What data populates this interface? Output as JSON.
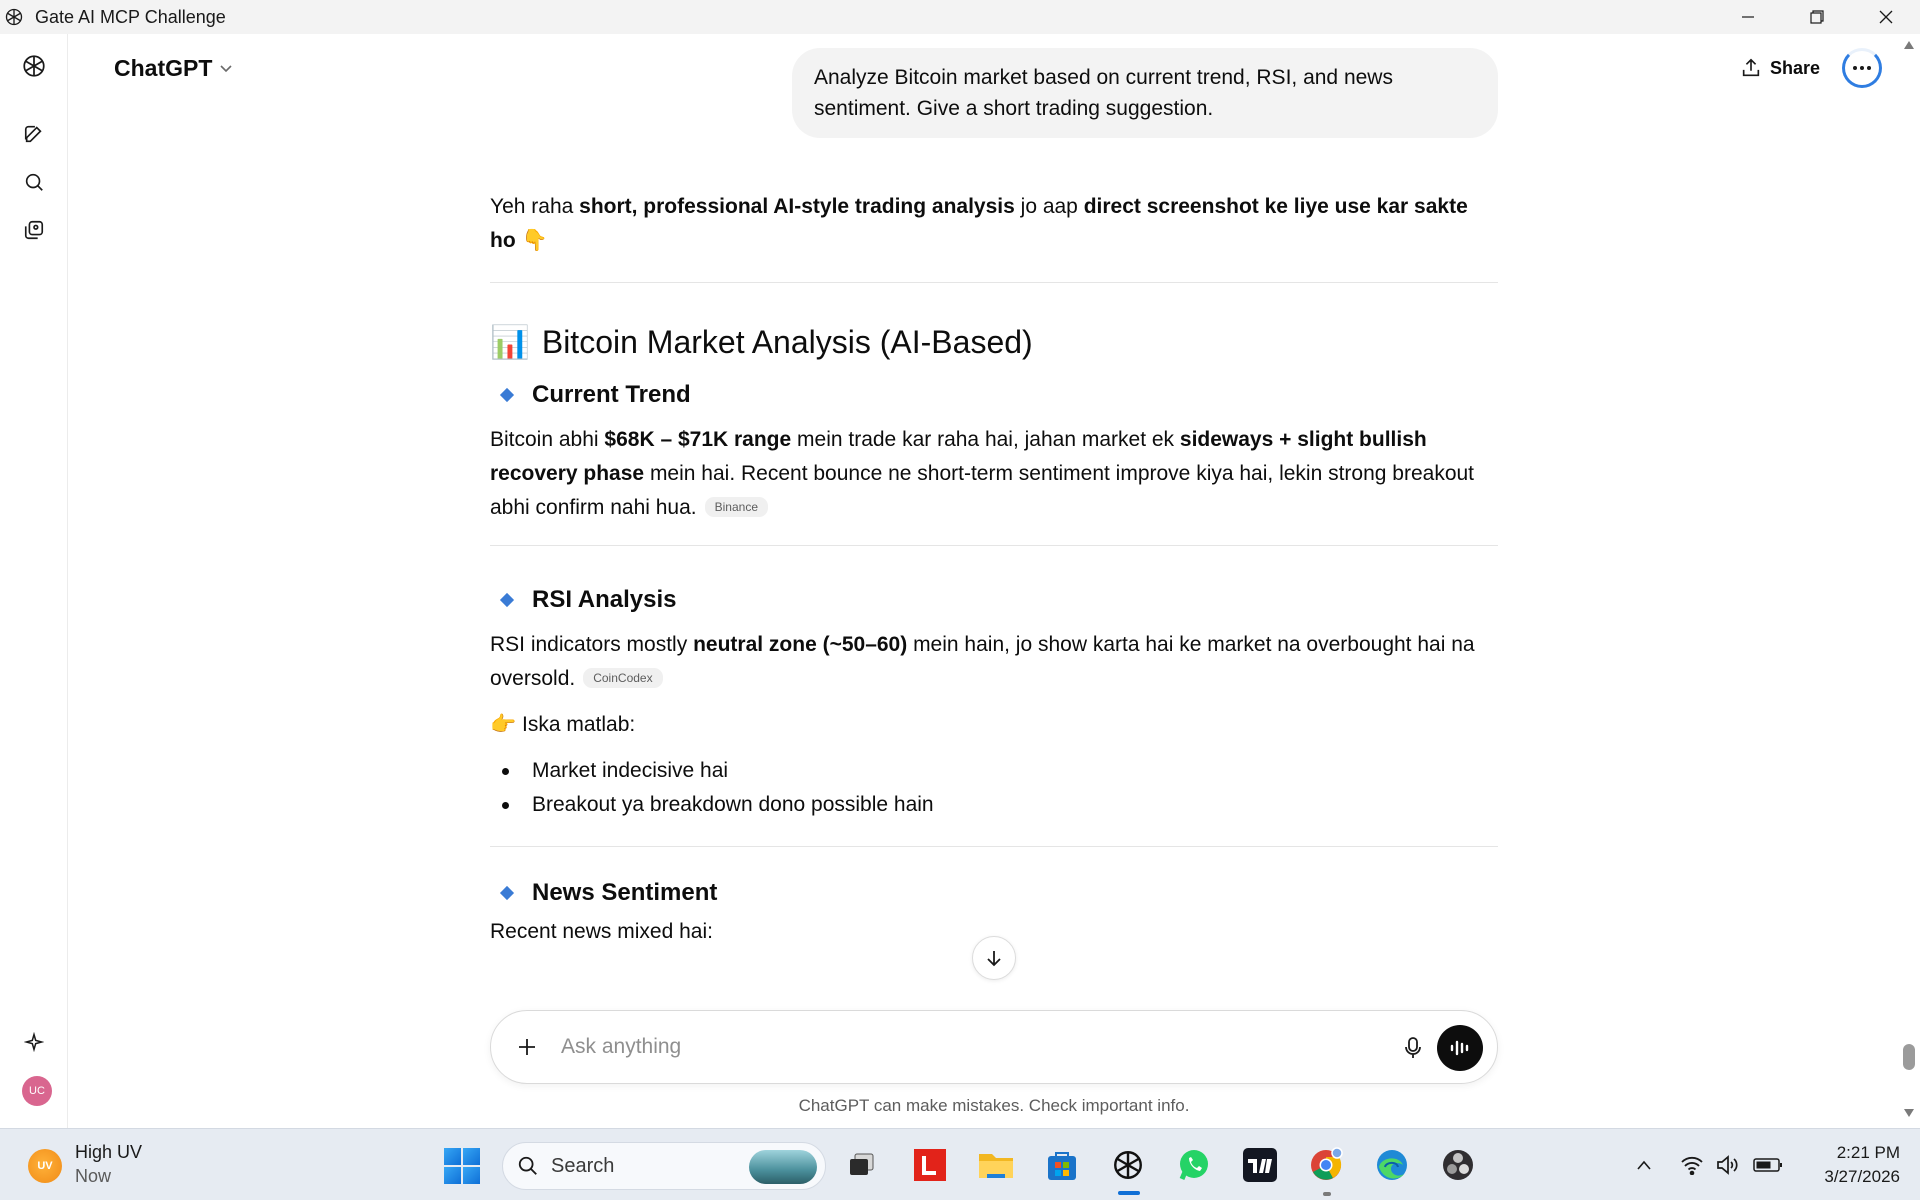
{
  "window": {
    "title": "Gate AI MCP Challenge"
  },
  "header": {
    "model_label": "ChatGPT",
    "share_label": "Share"
  },
  "user_message": "Analyze Bitcoin market based on current trend, RSI, and news sentiment. Give a short trading suggestion.",
  "response": {
    "intro": {
      "t1": "Yeh raha ",
      "b1": "short, professional AI-style trading analysis",
      "t2": " jo aap ",
      "b2": "direct screenshot ke liye use kar sakte ho",
      "emoji": "👇"
    },
    "heading": {
      "emoji": "📊",
      "text": "Bitcoin Market Analysis (AI-Based)"
    },
    "trend": {
      "title": "Current Trend",
      "t1": "Bitcoin abhi ",
      "b1": "$68K – $71K range",
      "t2": " mein trade kar raha hai, jahan market ek ",
      "b2": "sideways + slight bullish recovery phase",
      "t3": " mein hai. Recent bounce ne short-term sentiment improve kiya hai, lekin strong breakout abhi confirm nahi hua.",
      "citation": "Binance"
    },
    "rsi": {
      "title": "RSI Analysis",
      "t1": "RSI indicators mostly ",
      "b1": "neutral zone (~50–60)",
      "t2": " mein hain, jo show karta hai ke market na overbought hai na oversold.",
      "citation": "CoinCodex",
      "meaning_emoji": "👉",
      "meaning_label": "Iska matlab:",
      "bullets": [
        "Market indecisive hai",
        "Breakout ya breakdown dono possible hain"
      ]
    },
    "news": {
      "title": "News Sentiment",
      "text": "Recent news mixed hai:"
    }
  },
  "composer": {
    "placeholder": "Ask anything"
  },
  "disclaimer": "ChatGPT can make mistakes. Check important info.",
  "sidebar": {
    "avatar_initials": "UC"
  },
  "taskbar": {
    "weather": {
      "badge": "UV",
      "title": "High UV",
      "subtitle": "Now"
    },
    "search_label": "Search",
    "apps": [
      "task-view",
      "lenovo-vantage",
      "file-explorer",
      "microsoft-store",
      "chatgpt",
      "whatsapp",
      "tradingview",
      "chrome",
      "edge",
      "obs-studio"
    ],
    "time": "2:21 PM",
    "date": "3/27/2026"
  },
  "colors": {
    "accent_blue": "#2f7de1",
    "diamond": "#3a7bd5",
    "avatar": "#d9668f",
    "taskbar_bg": "#e6ebf2"
  }
}
